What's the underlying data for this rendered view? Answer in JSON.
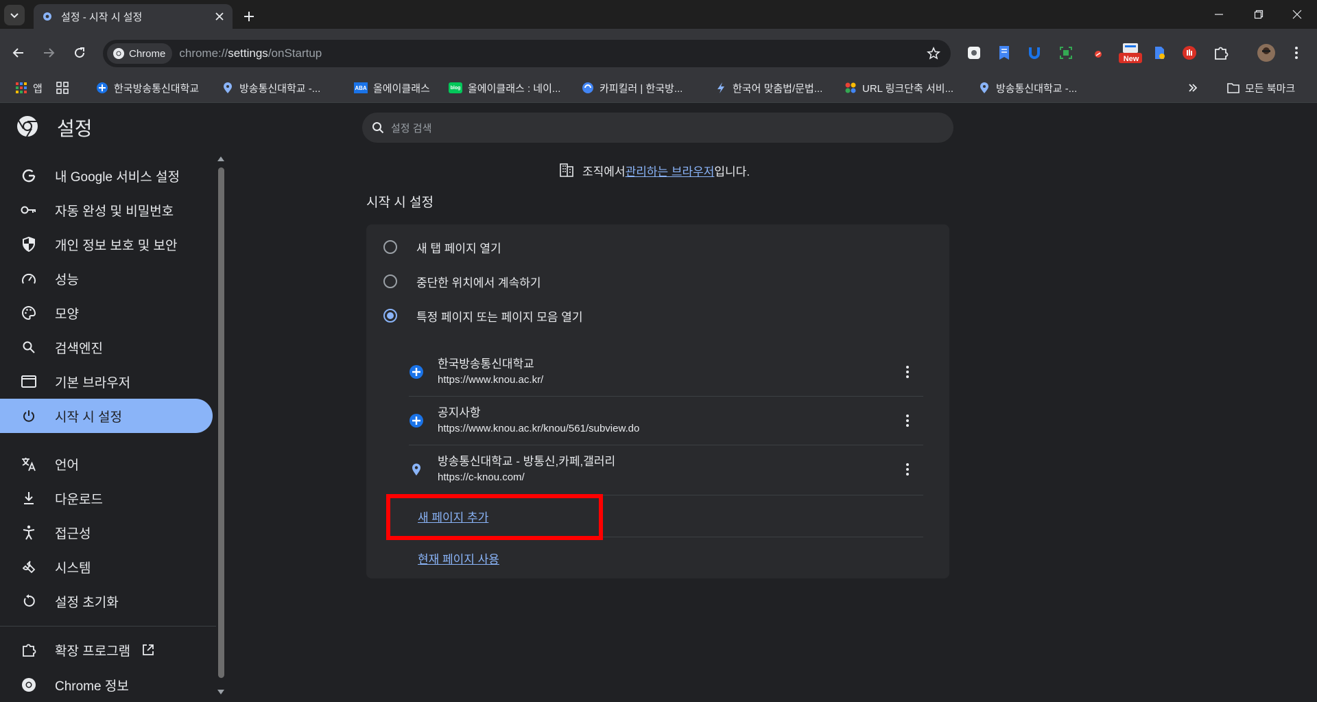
{
  "window": {
    "tab_title": "설정 - 시작 시 설정"
  },
  "toolbar": {
    "chip_label": "Chrome",
    "url_prefix": "chrome://",
    "url_host": "settings",
    "url_path": "/onStartup",
    "new_badge": "New"
  },
  "bookmarks": {
    "apps_label": "앱",
    "items": [
      "한국방송통신대학교",
      "방송통신대학교 -...",
      "올에이클래스",
      "올에이클래스 : 네이...",
      "카피킬러 | 한국방...",
      "한국어 맞춤법/문법...",
      "URL 링크단축 서비...",
      "방송통신대학교 -..."
    ],
    "all_bookmarks": "모든 북마크",
    "aba_badge": "ABA",
    "blog_badge": "blog"
  },
  "settings": {
    "title": "설정",
    "search_placeholder": "설정 검색"
  },
  "sidebar": {
    "items": [
      {
        "label": "내 Google 서비스 설정",
        "icon": "google-icon"
      },
      {
        "label": "자동 완성 및 비밀번호",
        "icon": "key-icon"
      },
      {
        "label": "개인 정보 보호 및 보안",
        "icon": "shield-icon"
      },
      {
        "label": "성능",
        "icon": "speedometer-icon"
      },
      {
        "label": "모양",
        "icon": "palette-icon"
      },
      {
        "label": "검색엔진",
        "icon": "search-icon"
      },
      {
        "label": "기본 브라우저",
        "icon": "browser-window-icon"
      },
      {
        "label": "시작 시 설정",
        "icon": "power-icon",
        "active": true
      },
      {
        "label": "언어",
        "icon": "translate-icon"
      },
      {
        "label": "다운로드",
        "icon": "download-icon"
      },
      {
        "label": "접근성",
        "icon": "accessibility-icon"
      },
      {
        "label": "시스템",
        "icon": "wrench-icon"
      },
      {
        "label": "설정 초기화",
        "icon": "reset-icon"
      },
      {
        "label": "확장 프로그램",
        "icon": "puzzle-icon"
      },
      {
        "label": "Chrome 정보",
        "icon": "chrome-icon"
      }
    ]
  },
  "main": {
    "managed_prefix": "조직에서 ",
    "managed_link": "관리하는 브라우저",
    "managed_suffix": "입니다.",
    "section_title": "시작 시 설정",
    "options": [
      {
        "label": "새 탭 페이지 열기",
        "checked": false
      },
      {
        "label": "중단한 위치에서 계속하기",
        "checked": false
      },
      {
        "label": "특정 페이지 또는 페이지 모음 열기",
        "checked": true
      }
    ],
    "pages": [
      {
        "name": "한국방송통신대학교",
        "url": "https://www.knou.ac.kr/"
      },
      {
        "name": "공지사항",
        "url": "https://www.knou.ac.kr/knou/561/subview.do"
      },
      {
        "name": "방송통신대학교 - 방통신,카페,갤러리",
        "url": "https://c-knou.com/"
      }
    ],
    "add_page": "새 페이지 추가",
    "use_current": "현재 페이지 사용"
  },
  "colors": {
    "accent": "#8ab4f8",
    "background": "#202124",
    "card": "#292a2d",
    "highlight": "#ff0000"
  }
}
